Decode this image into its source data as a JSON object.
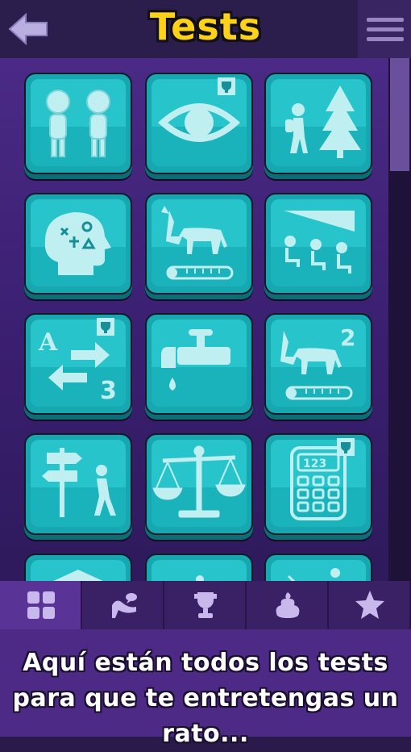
{
  "header": {
    "title": "Tests",
    "back_icon": "arrow-left-icon",
    "menu_icon": "hamburger-menu-icon"
  },
  "tests": [
    {
      "icon": "troll-faces-icon",
      "trophy": false
    },
    {
      "icon": "eye-icon",
      "trophy": true
    },
    {
      "icon": "hiker-tree-icon",
      "trophy": false
    },
    {
      "icon": "head-thoughts-icon",
      "trophy": false
    },
    {
      "icon": "donkey-thermometer-icon",
      "trophy": false
    },
    {
      "icon": "cinema-seats-icon",
      "trophy": false
    },
    {
      "icon": "letter-swap-icon",
      "trophy": true,
      "letter": "A",
      "number": "3"
    },
    {
      "icon": "faucet-drop-icon",
      "trophy": false
    },
    {
      "icon": "donkey-thermometer-2-icon",
      "trophy": false,
      "number": "2"
    },
    {
      "icon": "signpost-walker-icon",
      "trophy": false
    },
    {
      "icon": "balance-scale-icon",
      "trophy": false
    },
    {
      "icon": "calculator-icon",
      "trophy": true,
      "display": "123"
    }
  ],
  "tabs": [
    {
      "name": "tab-all-tests",
      "icon": "grid-icon",
      "active": true
    },
    {
      "name": "tab-psychologist",
      "icon": "therapy-couch-icon",
      "active": false
    },
    {
      "name": "tab-trophies",
      "icon": "trophy-icon",
      "active": false
    },
    {
      "name": "tab-poop",
      "icon": "poop-icon",
      "active": false
    },
    {
      "name": "tab-favorites",
      "icon": "star-icon",
      "active": false
    }
  ],
  "message": "Aquí están todos los tests para que te entretengas un rato...",
  "colors": {
    "tile": "#28c4cc",
    "title": "#ffd21a",
    "background": "#3a1f70",
    "active_tab": "#5a3396"
  }
}
